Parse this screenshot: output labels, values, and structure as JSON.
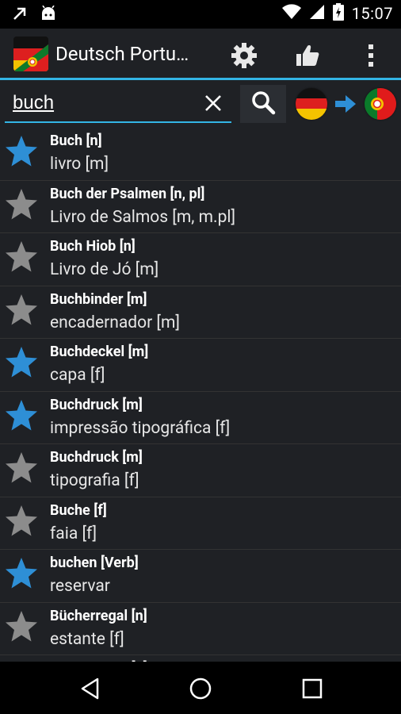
{
  "status": {
    "time": "15:07"
  },
  "app": {
    "title": "Deutsch Portu…"
  },
  "search": {
    "value": "buch"
  },
  "colors": {
    "accent": "#33b5e5",
    "star_favorite": "#2e8fd6",
    "star_normal": "#8c8c8c"
  },
  "results": [
    {
      "head": "Buch [n]",
      "trans": "livro [m]",
      "favorite": true
    },
    {
      "head": "Buch der Psalmen [n, pl]",
      "trans": "Livro de Salmos [m, m.pl]",
      "favorite": false
    },
    {
      "head": "Buch Hiob [n]",
      "trans": "Livro de Jó [m]",
      "favorite": false
    },
    {
      "head": "Buchbinder [m]",
      "trans": "encadernador [m]",
      "favorite": false
    },
    {
      "head": "Buchdeckel [m]",
      "trans": "capa [f]",
      "favorite": true
    },
    {
      "head": "Buchdruck [m]",
      "trans": "impressão tipográfica [f]",
      "favorite": true
    },
    {
      "head": "Buchdruck [m]",
      "trans": "tipografia [f]",
      "favorite": false
    },
    {
      "head": "Buche [f]",
      "trans": "faia [f]",
      "favorite": false
    },
    {
      "head": "buchen [Verb]",
      "trans": "reservar",
      "favorite": true
    },
    {
      "head": "Bücherregal [n]",
      "trans": "estante [f]",
      "favorite": false
    },
    {
      "head": "Bücherregal [n]",
      "trans": "",
      "favorite": false
    }
  ]
}
